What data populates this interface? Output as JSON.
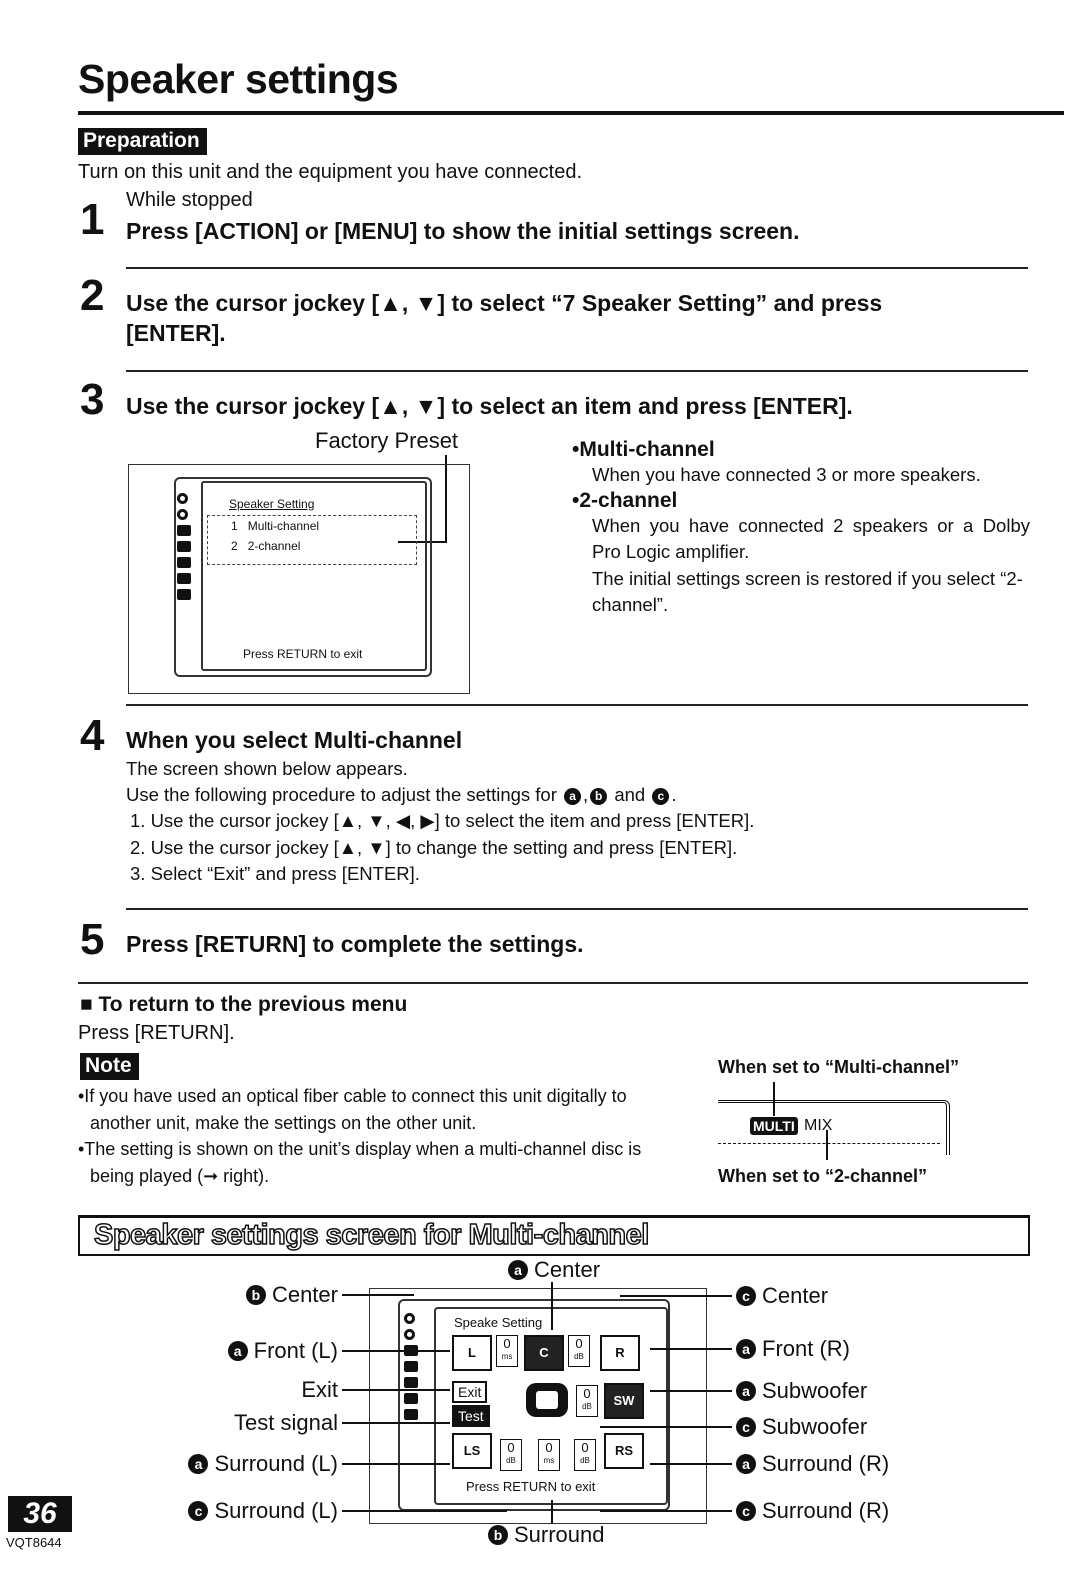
{
  "page": {
    "title": "Speaker settings",
    "number": "36",
    "model_code": "VQT8644"
  },
  "preparation": {
    "tag": "Preparation",
    "text": "Turn on this unit and the equipment you have connected."
  },
  "steps": [
    {
      "number": "1",
      "pre": "While stopped",
      "heading": "Press [ACTION] or [MENU] to show the initial settings screen."
    },
    {
      "number": "2",
      "heading_line1": "Use the cursor jockey [▲, ▼] to select “7 Speaker Setting” and press",
      "heading_line2": "[ENTER]."
    },
    {
      "number": "3",
      "heading": "Use the cursor jockey [▲, ▼] to select an item and press [ENTER]."
    },
    {
      "number": "4",
      "heading": "When you select Multi-channel",
      "intro1": "The screen shown below appears.",
      "intro2_pre": "Use the following procedure to adjust the settings for",
      "intro2_and": "and",
      "markers": [
        "a",
        "b",
        "c"
      ],
      "procedure": [
        "1.  Use the cursor jockey [▲, ▼, ◀, ▶] to select the item and press [ENTER].",
        "2.  Use the cursor jockey [▲, ▼] to change the setting and press [ENTER].",
        "3.  Select “Exit” and press [ENTER]."
      ]
    },
    {
      "number": "5",
      "heading": "Press [RETURN] to complete the settings."
    }
  ],
  "step3_screen": {
    "factory_preset_label": "Factory Preset",
    "menu_title": "Speaker Setting",
    "options": [
      {
        "num": "1",
        "label": "Multi-channel"
      },
      {
        "num": "2",
        "label": "2-channel"
      }
    ],
    "footer": "Press RETURN to exit"
  },
  "step3_options": [
    {
      "title": "•Multi-channel",
      "lines": [
        "When you have connected 3 or more speakers."
      ]
    },
    {
      "title": "•2-channel",
      "lines": [
        "When you have connected 2 speakers or a Dolby Pro Logic amplifier.",
        "The initial settings screen is restored if you select “2-channel”."
      ]
    }
  ],
  "return_section": {
    "heading": "■  To return to the previous menu",
    "text": "Press [RETURN]."
  },
  "note": {
    "tag": "Note",
    "items": [
      "•If you have used an optical fiber cable to connect this unit digitally to another unit, make the settings on the other unit.",
      "•The setting is shown on the unit’s display when a multi-channel disc is being played (➞ right)."
    ]
  },
  "display_indicator": {
    "label_multi": "When set to “Multi-channel”",
    "label_two": "When set to “2-channel”",
    "multi_text": "MULTI",
    "mix_text": "MIX"
  },
  "multi_screen": {
    "banner": "Speaker settings screen for Multi-channel",
    "menu_title": "Speake  Setting",
    "footer": "Press RETURN to exit",
    "exit_btn": "Exit",
    "test_btn": "Test",
    "speakers": {
      "L": "L",
      "C": "C",
      "R": "R",
      "SW": "SW",
      "LS": "LS",
      "RS": "RS"
    },
    "values": {
      "center_delay": {
        "v": "0",
        "u": "ms"
      },
      "center_level": {
        "v": "0",
        "u": "dB"
      },
      "sub_level": {
        "v": "0",
        "u": "dB"
      },
      "surr_l_level": {
        "v": "0",
        "u": "dB"
      },
      "surr_delay": {
        "v": "0",
        "u": "ms"
      },
      "surr_r_level": {
        "v": "0",
        "u": "dB"
      }
    },
    "callouts_left": [
      {
        "marker": "b",
        "label": "Center"
      },
      {
        "marker": "a",
        "label": "Front (L)"
      },
      {
        "marker": "",
        "label": "Exit"
      },
      {
        "marker": "",
        "label": "Test signal"
      },
      {
        "marker": "a",
        "label": "Surround (L)"
      },
      {
        "marker": "c",
        "label": "Surround (L)"
      }
    ],
    "callouts_right": [
      {
        "marker": "c",
        "label": "Center"
      },
      {
        "marker": "a",
        "label": "Front (R)"
      },
      {
        "marker": "a",
        "label": "Subwoofer"
      },
      {
        "marker": "c",
        "label": "Subwoofer"
      },
      {
        "marker": "a",
        "label": "Surround (R)"
      },
      {
        "marker": "c",
        "label": "Surround (R)"
      }
    ],
    "callout_top": {
      "marker": "a",
      "label": "Center"
    },
    "callout_bottom": {
      "marker": "b",
      "label": "Surround"
    }
  }
}
